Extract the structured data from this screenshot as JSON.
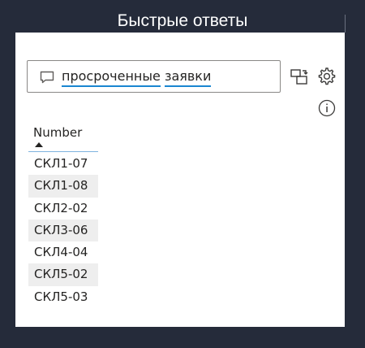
{
  "visual": {
    "title": "Быстрые ответы"
  },
  "qa": {
    "query_words": [
      "просроченные",
      "заявки"
    ],
    "icons": {
      "chat": "chat-bubble-icon",
      "convert": "convert-visual-icon",
      "settings": "gear-icon",
      "info": "info-icon"
    }
  },
  "table": {
    "column_header": "Number",
    "sort": "ascending",
    "rows": [
      "СКЛ1-07",
      "СКЛ1-08",
      "СКЛ2-02",
      "СКЛ3-06",
      "СКЛ4-04",
      "СКЛ5-02",
      "СКЛ5-03"
    ]
  },
  "colors": {
    "background": "#252b3a",
    "panel": "#ffffff",
    "accent_underline": "#1a86d1",
    "row_stripe": "#eeeeee"
  }
}
